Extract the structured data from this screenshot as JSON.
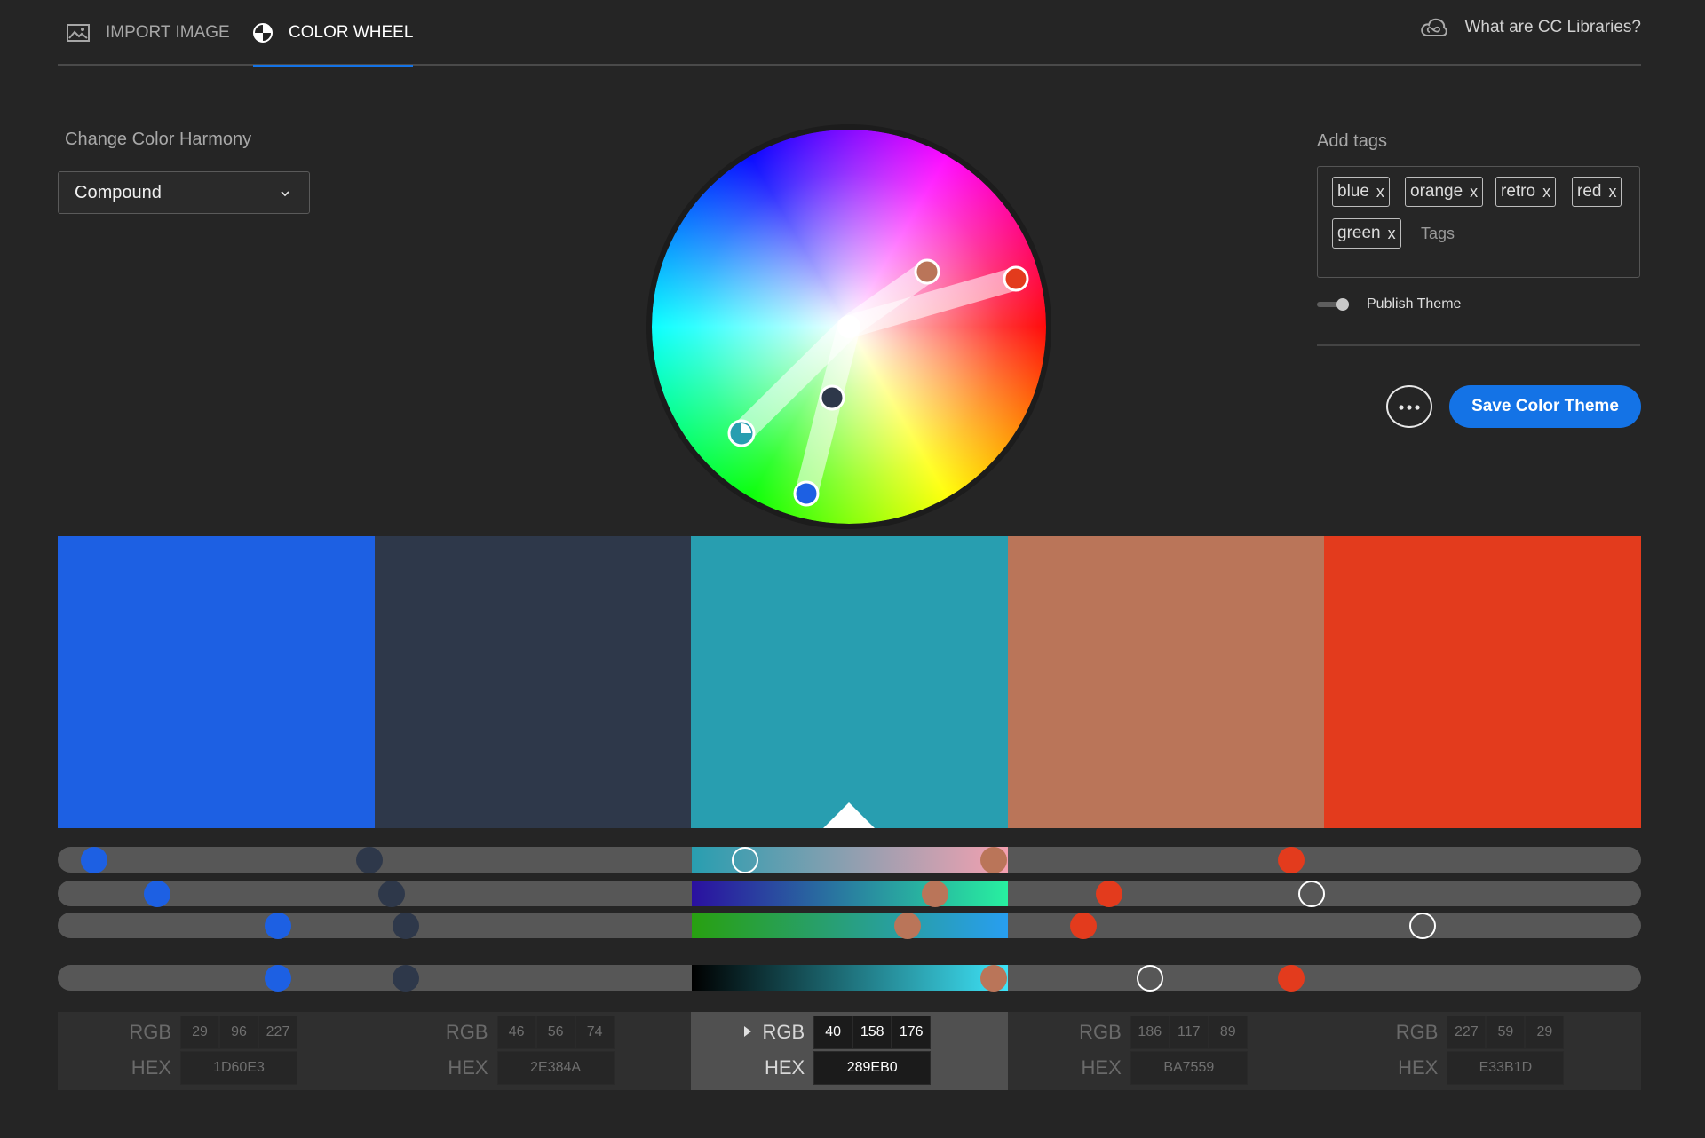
{
  "nav": {
    "tabs": [
      {
        "label": "IMPORT IMAGE",
        "active": false,
        "icon": "image-icon"
      },
      {
        "label": "COLOR WHEEL",
        "active": true,
        "icon": "color-wheel-icon"
      }
    ],
    "cc_link": "What are CC Libraries?"
  },
  "harmony": {
    "label": "Change Color Harmony",
    "selected": "Compound"
  },
  "tags": {
    "label": "Add tags",
    "items": [
      "blue",
      "orange",
      "retro",
      "red",
      "green"
    ],
    "remove_glyph": "x",
    "placeholder": "Tags"
  },
  "publish": {
    "label": "Publish Theme",
    "enabled": false
  },
  "actions": {
    "save_label": "Save Color Theme",
    "more_label": "•••"
  },
  "theme": {
    "active_index": 2,
    "swatches": [
      {
        "hex": "1D60E3",
        "rgb": [
          29,
          96,
          227
        ],
        "color": "#1D60E3"
      },
      {
        "hex": "2E384A",
        "rgb": [
          46,
          56,
          74
        ],
        "color": "#2E384A"
      },
      {
        "hex": "289EB0",
        "rgb": [
          40,
          158,
          176
        ],
        "color": "#289EB0"
      },
      {
        "hex": "BA7559",
        "rgb": [
          186,
          117,
          89
        ],
        "color": "#BA7559"
      },
      {
        "hex": "E33B1D",
        "rgb": [
          227,
          59,
          29
        ],
        "color": "#E33B1D"
      }
    ]
  },
  "slider_levels": {
    "comment_free": true,
    "rows": [
      [
        0.023,
        0.197,
        0.434,
        0.591,
        0.779
      ],
      [
        0.063,
        0.211,
        0.792,
        0.554,
        0.664
      ],
      [
        0.139,
        0.22,
        0.862,
        0.537,
        0.648
      ],
      [
        0.139,
        0.22,
        0.69,
        0.591,
        0.779
      ]
    ]
  },
  "value_labels": {
    "rgb": "RGB",
    "hex": "HEX"
  }
}
